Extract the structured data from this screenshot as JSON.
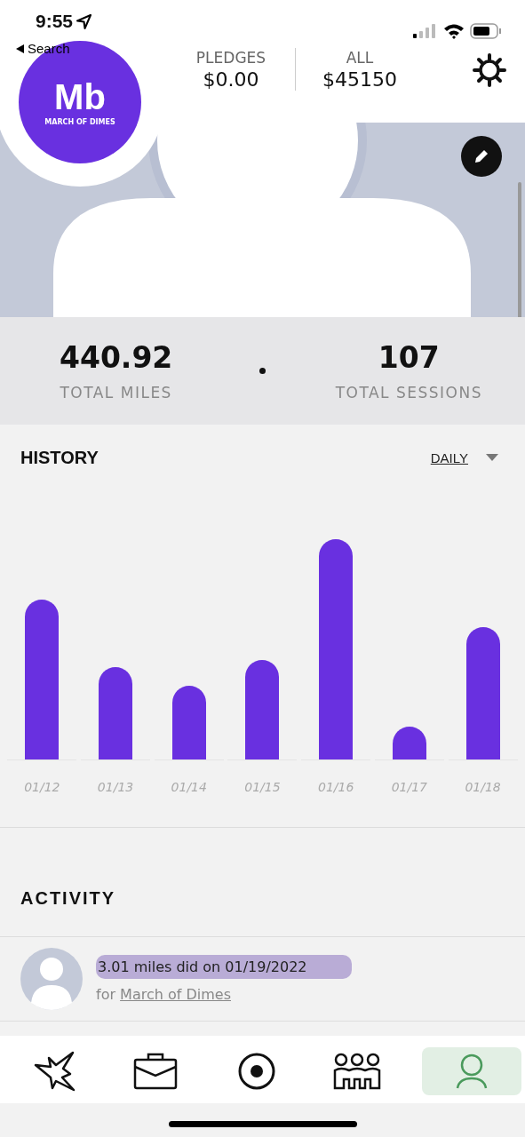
{
  "status_bar": {
    "time": "9:55",
    "back_label": "Search"
  },
  "header": {
    "logo_mark": "Mb",
    "logo_text": "MARCH OF DIMES",
    "stats": [
      {
        "label": "PLEDGES",
        "value": "$0.00"
      },
      {
        "label": "ALL",
        "value": "$45150"
      }
    ]
  },
  "totals": [
    {
      "value": "440.92",
      "label": "TOTAL MILES"
    },
    {
      "value": "107",
      "label": "TOTAL SESSIONS"
    }
  ],
  "history": {
    "title": "HISTORY",
    "period": "DAILY",
    "dates": [
      "01/12",
      "01/13",
      "01/14",
      "01/15",
      "01/16",
      "01/17",
      "01/18"
    ]
  },
  "activity": {
    "title": "ACTIVITY",
    "items": [
      {
        "summary": "3.01 miles did on 01/19/2022",
        "prefix": "for",
        "link": "March of Dimes",
        "highlighted": true
      }
    ]
  },
  "nav": [
    {
      "kind": "burst",
      "selected": false
    },
    {
      "kind": "briefcase",
      "selected": false
    },
    {
      "kind": "record",
      "selected": false
    },
    {
      "kind": "team",
      "selected": false
    },
    {
      "kind": "person",
      "selected": true
    }
  ]
}
